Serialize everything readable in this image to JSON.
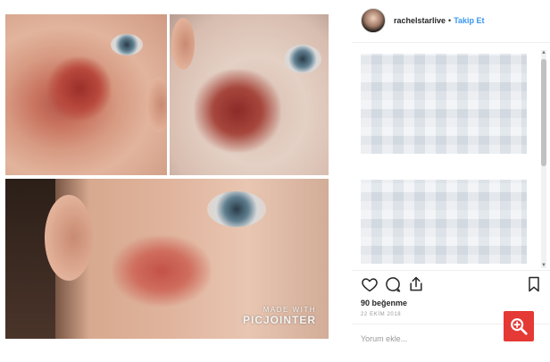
{
  "post": {
    "images": [
      {
        "name": "photo-top-left",
        "icon": "photo"
      },
      {
        "name": "photo-top-right",
        "icon": "photo"
      },
      {
        "name": "photo-bottom",
        "icon": "photo"
      }
    ],
    "watermark": {
      "line1": "MADE WITH",
      "line2": "PICJOINTER"
    }
  },
  "header": {
    "username": "rachelstarlive",
    "separator": "•",
    "follow_label": "Takip Et"
  },
  "comments": {
    "blurred": true
  },
  "actions": {
    "like_icon": "heart-icon",
    "comment_icon": "comment-icon",
    "share_icon": "share-icon",
    "save_icon": "bookmark-icon"
  },
  "likes": "90 beğenme",
  "date": "22 EKİM 2018",
  "comment_box": {
    "placeholder": "Yorum ekle..."
  },
  "zoom_button": {
    "icon": "zoom-in-icon",
    "color": "#e53935"
  },
  "colors": {
    "follow": "#3897f0",
    "text": "#262626",
    "muted": "#999999"
  }
}
